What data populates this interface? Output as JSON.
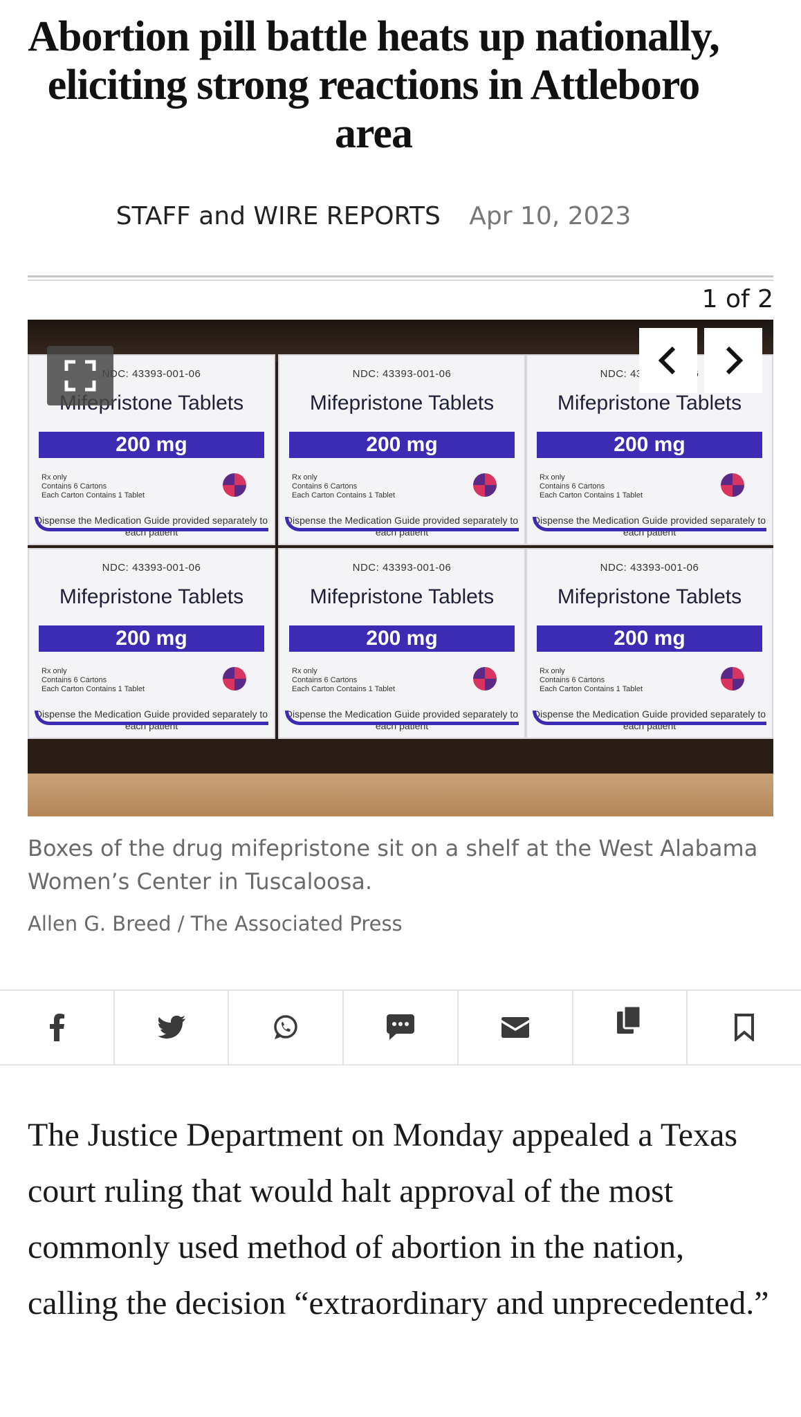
{
  "article": {
    "headline": "Abortion pill battle heats up nationally, eliciting strong reactions in Attleboro area",
    "author": "STAFF and WIRE REPORTS",
    "date": "Apr 10, 2023"
  },
  "gallery": {
    "counter": "1 of 2",
    "fullscreen_icon": "fullscreen-icon",
    "prev_icon": "chevron-left-icon",
    "next_icon": "chevron-right-icon",
    "photo_boxes": {
      "ndc": "NDC: 43393-001-06",
      "name": "Mifepristone Tablets",
      "dose": "200 mg",
      "rx": "Rx only",
      "contains": "Contains 6 Cartons",
      "each": "Each Carton Contains 1 Tablet",
      "guide": "Dispense the Medication Guide provided separately to each patient"
    },
    "caption": "Boxes of the drug mifepristone sit on a shelf at the West Alabama Women’s Center in Tuscaloosa.",
    "credit": "Allen G. Breed / The Associated Press"
  },
  "share_bar": {
    "icons": [
      "facebook-icon",
      "twitter-icon",
      "whatsapp-icon",
      "sms-icon",
      "email-icon",
      "copy-link-icon",
      "bookmark-icon"
    ]
  },
  "body": {
    "paragraph_1": "The Justice Department on Monday appealed a Texas court ruling that would halt approval of the most commonly used method of abortion in the nation, calling the decision “extraordinary and unprecedented.”"
  },
  "colors": {
    "accent_purple": "#3c2bb3",
    "caption_gray": "#6a6a6a",
    "divider": "#e3e3e3"
  }
}
